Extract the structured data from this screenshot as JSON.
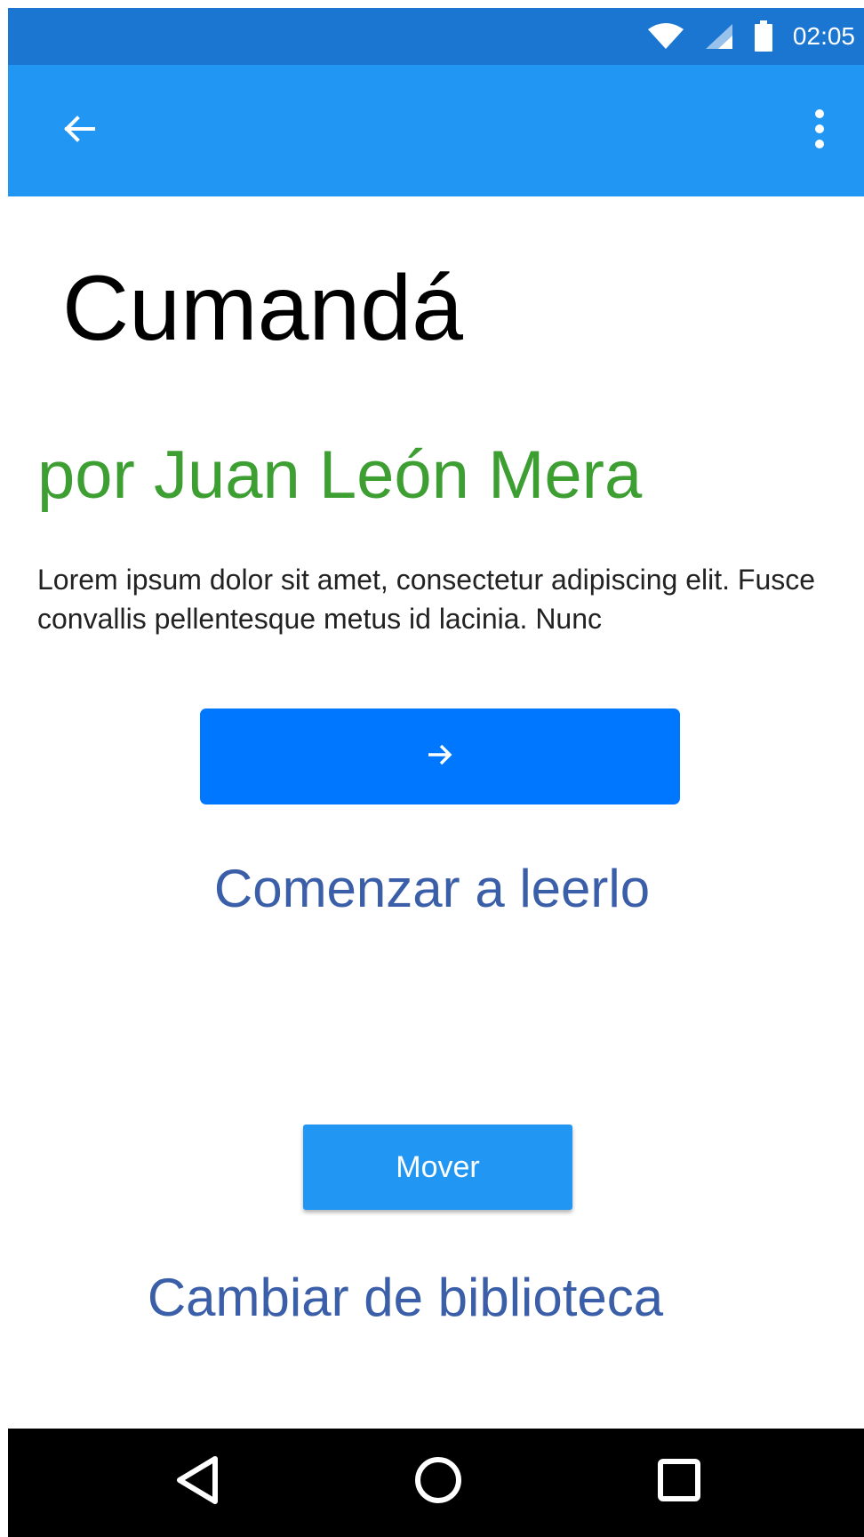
{
  "status_bar": {
    "time": "02:05",
    "icons": [
      "wifi-icon",
      "cellular-signal-icon",
      "battery-icon"
    ]
  },
  "app_bar": {
    "back_icon": "arrow-left-icon",
    "menu_icon": "more-vertical-icon",
    "color": "#2196f2"
  },
  "book": {
    "title": "Cumandá",
    "author": "por Juan León Mera",
    "description": "Lorem ipsum dolor sit amet, consectetur adipiscing elit. Fusce convallis pellentesque metus id lacinia. Nunc"
  },
  "actions": {
    "start_icon": "arrow-right-icon",
    "start_label": "Comenzar a leerlo",
    "move_button": "Mover",
    "change_library_label": "Cambiar de biblioteca"
  },
  "nav_bar": {
    "icons": [
      "back-triangle-icon",
      "home-circle-icon",
      "recents-square-icon"
    ]
  },
  "colors": {
    "status_bar": "#1b76d2",
    "title": "#000000",
    "author": "#3d9e32",
    "start_button": "#0077ff",
    "link_text": "#3a5ea8"
  }
}
